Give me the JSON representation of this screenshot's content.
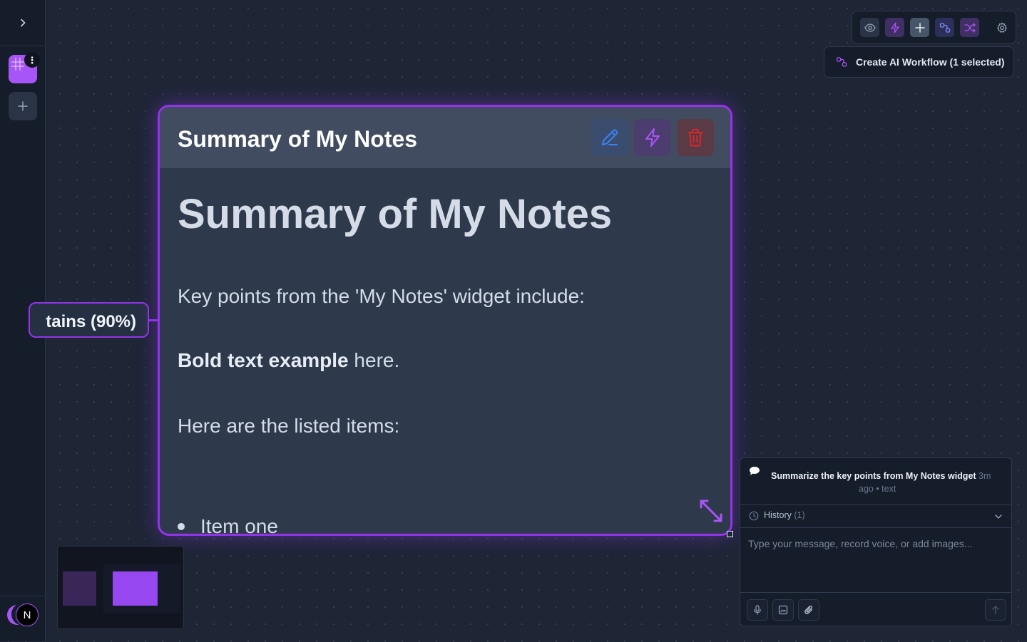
{
  "canvas": {
    "connected_node": {
      "label": "tains (90%)"
    }
  },
  "toolbar": {
    "workflow_button_label": "Create AI Workflow (1 selected)"
  },
  "note_card": {
    "title": "Summary of My Notes",
    "content": {
      "heading": "Summary of My Notes",
      "intro": "Key points from the 'My Notes' widget include:",
      "bold_text": "Bold text example",
      "bold_suffix": " here.",
      "list_intro": "Here are the listed items:",
      "list_items": [
        "Item one"
      ]
    }
  },
  "chat": {
    "message": {
      "text": "Summarize the key points from My Notes widget",
      "time": "3m",
      "meta": "ago • text"
    },
    "history": {
      "label": "History",
      "count": "(1)"
    },
    "input_placeholder": "Type your message, record voice, or add images..."
  },
  "colors": {
    "accent": "#9333ea",
    "canvas_bg": "#1e2636",
    "card_bg": "#2e394c",
    "delete_red": "#dc2626"
  }
}
